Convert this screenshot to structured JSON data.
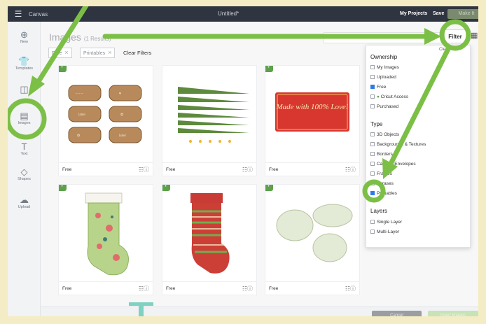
{
  "topbar": {
    "app_name": "Canvas",
    "doc_title": "Untitled*",
    "my_projects": "My Projects",
    "save": "Save",
    "make_it": "Make It"
  },
  "sidebar": {
    "items": [
      {
        "label": "New",
        "icon": "plus-circle-icon"
      },
      {
        "label": "Templates",
        "icon": "shirt-icon"
      },
      {
        "label": "Projects",
        "icon": "book-icon"
      },
      {
        "label": "Images",
        "icon": "image-icon"
      },
      {
        "label": "Text",
        "icon": "text-icon"
      },
      {
        "label": "Shapes",
        "icon": "shapes-icon"
      },
      {
        "label": "Upload",
        "icon": "upload-icon"
      }
    ]
  },
  "main": {
    "heading": "Images",
    "heading_sub": "(1 Results)",
    "filter_button": "Filter",
    "chips": [
      "Free",
      "Printables"
    ],
    "clear_filters": "Clear Filters",
    "cards": [
      {
        "label": "Free",
        "art": "labels"
      },
      {
        "label": "Free",
        "art": "stripes"
      },
      {
        "label": "Free",
        "art": "made-with-love"
      },
      {
        "label": "Free",
        "art": "stocking-green"
      },
      {
        "label": "Free",
        "art": "stocking-red"
      },
      {
        "label": "Free",
        "art": "ornate-labels"
      }
    ],
    "made_with_love_text": "Made with 100% Love!",
    "cancel_button": "Cancel",
    "insert_button": "Insert Images"
  },
  "filter_panel": {
    "clear": "Clear",
    "ownership_title": "Ownership",
    "ownership": [
      {
        "label": "My Images",
        "checked": false
      },
      {
        "label": "Uploaded",
        "checked": false
      },
      {
        "label": "Free",
        "checked": true
      },
      {
        "label": "Cricut Access",
        "checked": false
      },
      {
        "label": "Purchased",
        "checked": false
      }
    ],
    "type_title": "Type",
    "type": [
      {
        "label": "3D Objects",
        "checked": false
      },
      {
        "label": "Backgrounds & Textures",
        "checked": false
      },
      {
        "label": "Borders",
        "checked": false
      },
      {
        "label": "Cards & Envelopes",
        "checked": false
      },
      {
        "label": "Frames",
        "checked": false
      },
      {
        "label": "Phrases",
        "checked": false
      },
      {
        "label": "Printables",
        "checked": true
      }
    ],
    "layers_title": "Layers",
    "layers": [
      {
        "label": "Single Layer",
        "checked": false
      },
      {
        "label": "Multi-Layer",
        "checked": false
      }
    ]
  },
  "colors": {
    "annotation_green": "#7cbf46",
    "topbar": "#2f3540",
    "checkbox_on": "#2f7be3",
    "teal": "#7fd1c2"
  }
}
